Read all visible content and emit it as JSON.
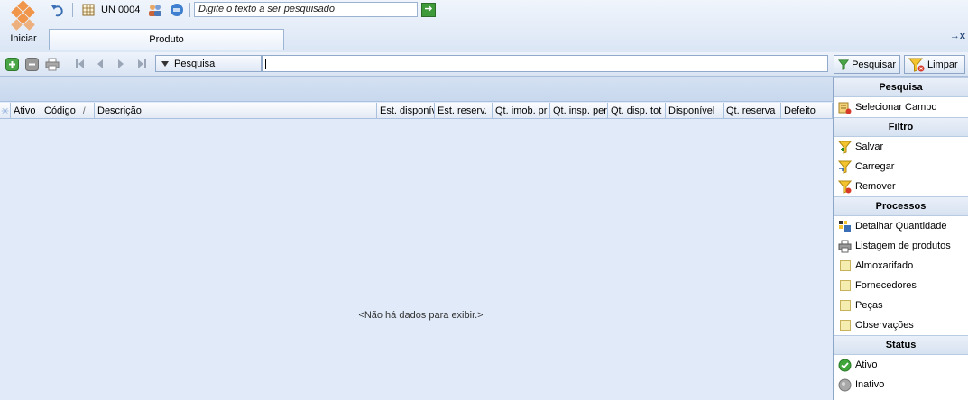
{
  "toolbar": {
    "start_label": "Iniciar",
    "unit_label": "UN 0004",
    "search_placeholder": "Digite o texto a ser pesquisado"
  },
  "tabs": [
    {
      "label": "Produto",
      "active": true
    }
  ],
  "tab_controls": "→x",
  "navbar": {
    "search_mode_label": "Pesquisa",
    "search_value": "",
    "search_button_label": "Pesquisar",
    "clear_button_label": "Limpar"
  },
  "grid": {
    "columns": [
      "Ativo",
      "Código",
      "Descrição",
      "Est. disponív",
      "Est. reserv.",
      "Qt. imob. pr",
      "Qt. insp. per",
      "Qt. disp. tot",
      "Disponível",
      "Qt. reserva",
      "Defeito"
    ],
    "sort_indicator": "/",
    "empty_message": "<Não há dados para exibir.>"
  },
  "panel": {
    "sections": [
      {
        "header": "Pesquisa",
        "items": [
          {
            "label": "Selecionar Campo",
            "icon": "select-field-icon"
          }
        ]
      },
      {
        "header": "Filtro",
        "items": [
          {
            "label": "Salvar",
            "icon": "filter-save-icon"
          },
          {
            "label": "Carregar",
            "icon": "filter-load-icon"
          },
          {
            "label": "Remover",
            "icon": "filter-remove-icon"
          }
        ]
      },
      {
        "header": "Processos",
        "items": [
          {
            "label": "Detalhar Quantidade",
            "icon": "detail-quantity-icon"
          },
          {
            "label": "Listagem de produtos",
            "icon": "printer-icon"
          },
          {
            "label": "Almoxarifado",
            "icon": "generic-item-icon"
          },
          {
            "label": "Fornecedores",
            "icon": "generic-item-icon"
          },
          {
            "label": "Peças",
            "icon": "generic-item-icon"
          },
          {
            "label": "Observações",
            "icon": "generic-item-icon"
          }
        ]
      },
      {
        "header": "Status",
        "items": [
          {
            "label": "Ativo",
            "icon": "status-active-icon"
          },
          {
            "label": "Inativo",
            "icon": "status-inactive-icon"
          }
        ]
      }
    ]
  },
  "colors": {
    "accent": "#f0954a",
    "header_bg": "#dce7f6",
    "grid_bg": "#e0eaf8",
    "active_green": "#3f9a3a"
  }
}
